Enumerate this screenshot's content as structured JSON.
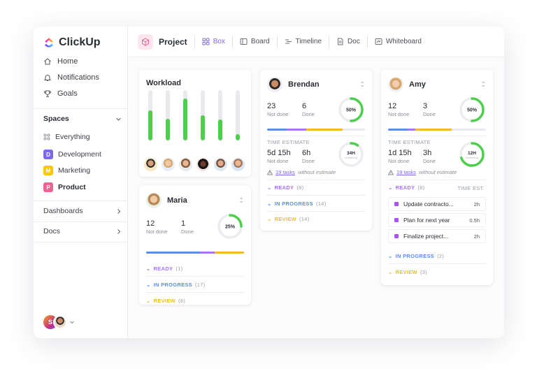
{
  "brand": {
    "name": "ClickUp"
  },
  "sidebar": {
    "nav": [
      {
        "label": "Home",
        "icon": "home-icon"
      },
      {
        "label": "Notifications",
        "icon": "bell-icon"
      },
      {
        "label": "Goals",
        "icon": "trophy-icon"
      }
    ],
    "spaces_label": "Spaces",
    "everything_label": "Everything",
    "spaces": [
      {
        "letter": "D",
        "label": "Development",
        "color": "#7b68ee"
      },
      {
        "letter": "M",
        "label": "Marketing",
        "color": "#ffc800"
      },
      {
        "letter": "P",
        "label": "Product",
        "color": "#f06292"
      }
    ],
    "dashboards_label": "Dashboards",
    "docs_label": "Docs",
    "user_initial": "S"
  },
  "topbar": {
    "project_title": "Project",
    "tabs": [
      {
        "label": "Box",
        "icon": "grid-icon",
        "active": true
      },
      {
        "label": "Board",
        "icon": "board-icon",
        "active": false
      },
      {
        "label": "Timeline",
        "icon": "timeline-icon",
        "active": false
      },
      {
        "label": "Doc",
        "icon": "doc-icon",
        "active": false
      },
      {
        "label": "Whiteboard",
        "icon": "whiteboard-icon",
        "active": false
      }
    ]
  },
  "workload": {
    "title": "Workload",
    "bars": [
      0.6,
      0.43,
      0.84,
      0.5,
      0.42,
      0.12
    ]
  },
  "labels": {
    "not_done": "Not done",
    "done": "Done",
    "time_estimate": "TIME ESTIMATE",
    "time_est_short": "TIME EST.",
    "ready": "READY",
    "in_progress": "IN PROGRESS",
    "review": "REVIEW",
    "tasks_link": "19 tasks",
    "without_estimate": "without estimate",
    "remaining": "remaining"
  },
  "maria": {
    "name": "Maria",
    "not_done": "12",
    "done": "1",
    "percent": "25%",
    "ring": 0.25,
    "ready_count": "(1)",
    "in_progress_count": "(17)",
    "review_count": "(8)"
  },
  "brendan": {
    "name": "Brendan",
    "not_done": "23",
    "done": "6",
    "percent": "50%",
    "ring": 0.5,
    "est_not_done": "5d 15h",
    "est_done": "6h",
    "est_remaining": "34H",
    "est_ring": 0.1,
    "ready_count": "(8)",
    "in_progress_count": "(14)",
    "review_count": "(14)"
  },
  "amy": {
    "name": "Amy",
    "not_done": "12",
    "done": "3",
    "percent": "50%",
    "ring": 0.5,
    "est_not_done": "1d 15h",
    "est_done": "3h",
    "est_remaining": "12H",
    "est_ring": 0.7,
    "ready_count": "(8)",
    "in_progress_count": "(2)",
    "review_count": "(3)",
    "tasks": [
      {
        "name": "Update contracto...",
        "est": "2h"
      },
      {
        "name": "Plan for next year",
        "est": "0.5h"
      },
      {
        "name": "Finalize project...",
        "est": "2h"
      }
    ]
  },
  "colors": {
    "accent": "#7b68ee",
    "green": "#4cd04c",
    "ready": "#a875ff",
    "in_progress": "#5b8def",
    "review": "#f2bb2e"
  }
}
